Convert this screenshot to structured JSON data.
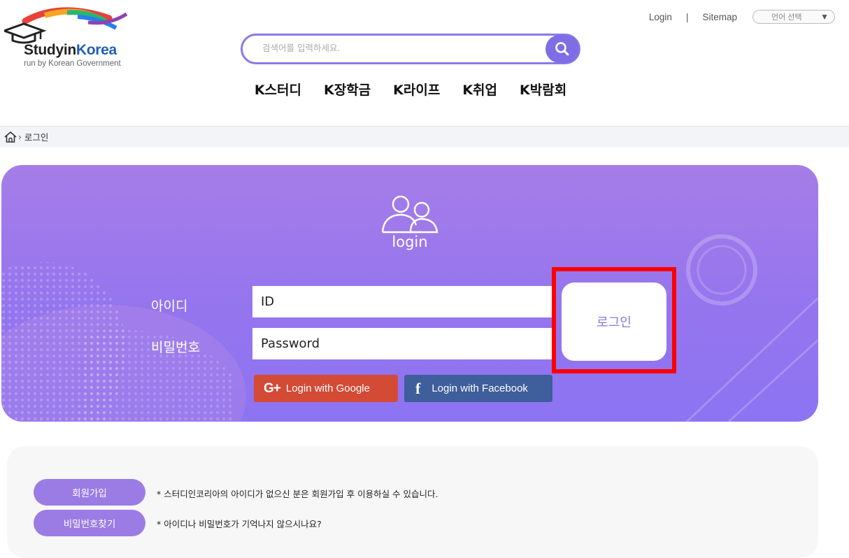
{
  "header": {
    "logo": {
      "name": "StudyinKorea",
      "name_main": "Studyin",
      "name_accent": "Korea",
      "subtitle": "run by Korean Government"
    },
    "util": {
      "login": "Login",
      "separator": "|",
      "sitemap": "Sitemap",
      "language_select": "언어 선택"
    },
    "search": {
      "placeholder": "검색어를 입력하세요."
    },
    "gnb": [
      "K스터디",
      "K장학금",
      "K라이프",
      "K취업",
      "K박람회"
    ]
  },
  "breadcrumb": {
    "current": "로그인"
  },
  "login": {
    "title": "login",
    "id_label": "아이디",
    "id_value": "ID",
    "password_label": "비밀번호",
    "password_value": "Password",
    "submit": "로그인",
    "google": "Login with Google",
    "facebook": "Login with Facebook"
  },
  "info": {
    "signup_button": "회원가입",
    "signup_note": "* 스터디인코리아의 아이디가 없으신 분은 회원가입 후 이용하실 수 있습니다.",
    "find_button": "비밀번호찾기",
    "find_note": "* 아이디나 비밀번호가 기억나지 않으시나요?"
  },
  "colors": {
    "accent": "#8c79e8",
    "panel": "#9575ee",
    "google": "#d34a35",
    "facebook": "#3e5e9c",
    "highlight": "#ff0000"
  }
}
